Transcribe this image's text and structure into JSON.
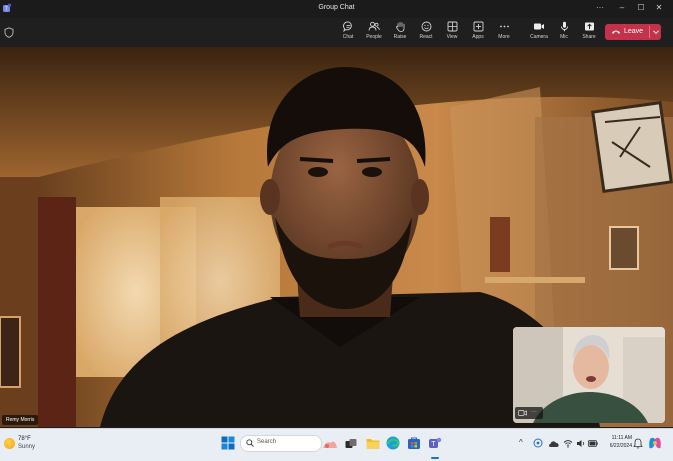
{
  "window": {
    "title": "Group Chat",
    "more": "···",
    "minimize": "–",
    "maximize": "☐",
    "close": "✕"
  },
  "toolbar": {
    "items": [
      {
        "label": "Chat",
        "icon": "chat-icon"
      },
      {
        "label": "People",
        "icon": "people-icon"
      },
      {
        "label": "Raise",
        "icon": "raise-hand-icon"
      },
      {
        "label": "React",
        "icon": "react-icon"
      },
      {
        "label": "View",
        "icon": "view-icon"
      },
      {
        "label": "Apps",
        "icon": "apps-icon"
      },
      {
        "label": "More",
        "icon": "more-icon"
      },
      {
        "label": "Camera",
        "icon": "camera-icon"
      },
      {
        "label": "Mic",
        "icon": "mic-icon"
      },
      {
        "label": "Share",
        "icon": "share-icon"
      }
    ],
    "leave_label": "Leave",
    "leave_color": "#c4314b"
  },
  "stage": {
    "participant_name": "Remy Morris",
    "self_view_controls": "···"
  },
  "taskbar": {
    "weather": {
      "temp": "78°F",
      "condition": "Sunny"
    },
    "search_placeholder": "Search",
    "pinned": [
      "start-icon",
      "search-icon",
      "widgets-icon",
      "task-view-icon",
      "file-explorer-icon",
      "edge-icon",
      "store-icon",
      "teams-icon"
    ],
    "tray_chevron": "^",
    "time": "11:11 AM",
    "date": "6/22/2024"
  }
}
